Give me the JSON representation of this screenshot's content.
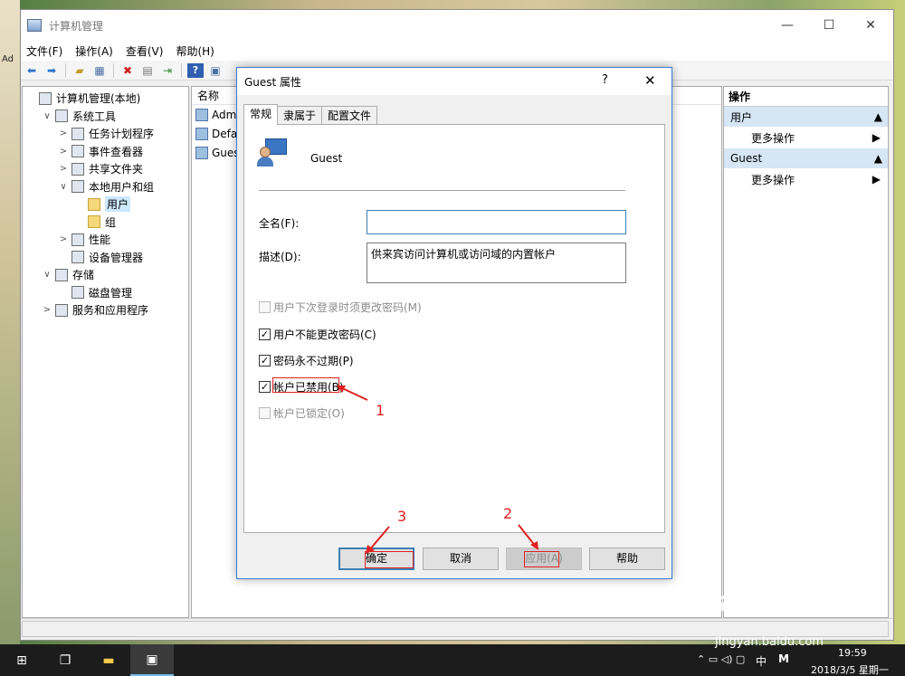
{
  "desktop": {
    "ad_text": "Ad"
  },
  "window": {
    "title": "计算机管理",
    "controls": {
      "minimize": "—",
      "maximize": "☐",
      "close": "✕"
    }
  },
  "menubar": [
    "文件(F)",
    "操作(A)",
    "查看(V)",
    "帮助(H)"
  ],
  "toolbar": {
    "icons": [
      "back-icon",
      "forward-icon",
      "up-folder-icon",
      "show-hide-tree-icon",
      "delete-icon",
      "properties-icon",
      "export-icon",
      "help-icon",
      "view-icon"
    ]
  },
  "tree": [
    {
      "label": "计算机管理(本地)",
      "indent": 0,
      "twisty": "",
      "icon": "computer-icon"
    },
    {
      "label": "系统工具",
      "indent": 1,
      "twisty": "∨",
      "icon": "tools-icon"
    },
    {
      "label": "任务计划程序",
      "indent": 2,
      "twisty": ">",
      "icon": "clock-icon"
    },
    {
      "label": "事件查看器",
      "indent": 2,
      "twisty": ">",
      "icon": "event-viewer-icon"
    },
    {
      "label": "共享文件夹",
      "indent": 2,
      "twisty": ">",
      "icon": "shared-folder-icon"
    },
    {
      "label": "本地用户和组",
      "indent": 2,
      "twisty": "∨",
      "icon": "users-icon"
    },
    {
      "label": "用户",
      "indent": 3,
      "twisty": "",
      "icon": "folder-icon",
      "selected": true
    },
    {
      "label": "组",
      "indent": 3,
      "twisty": "",
      "icon": "folder-icon"
    },
    {
      "label": "性能",
      "indent": 2,
      "twisty": ">",
      "icon": "performance-icon"
    },
    {
      "label": "设备管理器",
      "indent": 2,
      "twisty": "",
      "icon": "device-manager-icon"
    },
    {
      "label": "存储",
      "indent": 1,
      "twisty": "∨",
      "icon": "storage-icon"
    },
    {
      "label": "磁盘管理",
      "indent": 2,
      "twisty": "",
      "icon": "disk-icon"
    },
    {
      "label": "服务和应用程序",
      "indent": 1,
      "twisty": ">",
      "icon": "services-icon"
    }
  ],
  "list": {
    "column_header": "名称",
    "rows": [
      "Admi",
      "Defa",
      "Guest"
    ]
  },
  "actions": {
    "header": "操作",
    "sections": [
      {
        "title": "用户",
        "item": "更多操作"
      },
      {
        "title": "Guest",
        "item": "更多操作"
      }
    ]
  },
  "dialog": {
    "title": "Guest 属性",
    "help": "?",
    "close": "✕",
    "tabs": [
      "常规",
      "隶属于",
      "配置文件"
    ],
    "active_tab": "常规",
    "user_name": "Guest",
    "fullname_label": "全名(F):",
    "fullname_value": "",
    "description_label": "描述(D):",
    "description_value": "供来宾访问计算机或访问域的内置帐户",
    "checkboxes": [
      {
        "label": "用户下次登录时须更改密码(M)",
        "checked": false,
        "disabled": true
      },
      {
        "label": "用户不能更改密码(C)",
        "checked": true,
        "disabled": false
      },
      {
        "label": "密码永不过期(P)",
        "checked": true,
        "disabled": false
      },
      {
        "label": "帐户已禁用(B)",
        "checked": true,
        "disabled": false
      },
      {
        "label": "帐户已锁定(O)",
        "checked": false,
        "disabled": true
      }
    ],
    "buttons": {
      "ok": "确定",
      "cancel": "取消",
      "apply": "应用(A)",
      "help": "帮助"
    }
  },
  "annotations": {
    "step1": "1",
    "step2": "2",
    "step3": "3",
    "color": "#e02020"
  },
  "taskbar": {
    "clock_time": "19:59",
    "clock_date": "2018/3/5 星期一",
    "ime": "中",
    "ime_mode": "M"
  },
  "watermark": {
    "logo": "Bai du 经验",
    "url": "jingyan.baidu.com"
  }
}
